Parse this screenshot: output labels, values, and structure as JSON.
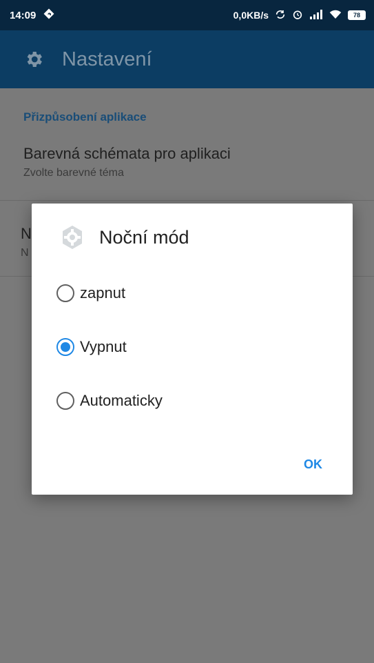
{
  "status_bar": {
    "time": "14:09",
    "net_speed": "0,0KB/s",
    "battery": "78"
  },
  "app_bar": {
    "title": "Nastavení",
    "icon": "gear-icon"
  },
  "settings": {
    "section_header": "Přizpůsobení aplikace",
    "items": [
      {
        "title": "Barevná schémata pro aplikaci",
        "subtitle": "Zvolte barevné téma"
      },
      {
        "title": "N",
        "subtitle": "N"
      }
    ]
  },
  "dialog": {
    "title": "Noční mód",
    "icon": "settings-badge-icon",
    "options": [
      {
        "label": "zapnut",
        "checked": false
      },
      {
        "label": "Vypnut",
        "checked": true
      },
      {
        "label": "Automaticky",
        "checked": false
      }
    ],
    "ok_label": "OK"
  },
  "colors": {
    "status_bar": "#08263f",
    "app_bar": "#0c3d63",
    "accent": "#1e88e5",
    "scrim": "#7a7a7a"
  }
}
